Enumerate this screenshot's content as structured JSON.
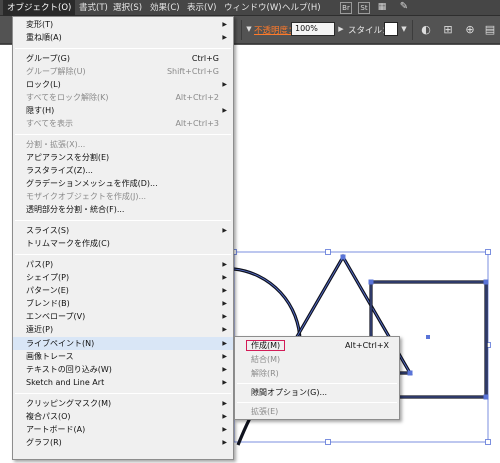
{
  "menubar": {
    "items": [
      "オブジェクト(O)",
      "書式(T)",
      "選択(S)",
      "効果(C)",
      "表示(V)",
      "ウィンドウ(W)",
      "ヘルプ(H)"
    ],
    "icon_br": "Br",
    "icon_st": "St"
  },
  "controlbar": {
    "opacity_label": "不透明度：",
    "opacity_value": "100%",
    "style_label": "スタイル：",
    "opacity_color": "#ff7a2a"
  },
  "menu": {
    "items": [
      {
        "label": "変形(T)",
        "submenu": true
      },
      {
        "label": "重ね順(A)",
        "submenu": true
      },
      {
        "label": "グループ(G)",
        "shortcut": "Ctrl+G"
      },
      {
        "label": "グループ解除(U)",
        "shortcut": "Shift+Ctrl+G",
        "disabled": true
      },
      {
        "label": "ロック(L)",
        "submenu": true
      },
      {
        "label": "すべてをロック解除(K)",
        "shortcut": "Alt+Ctrl+2",
        "disabled": true
      },
      {
        "label": "隠す(H)",
        "submenu": true
      },
      {
        "label": "すべてを表示",
        "shortcut": "Alt+Ctrl+3",
        "disabled": true
      },
      {
        "label": "分割・拡張(X)...",
        "disabled": true
      },
      {
        "label": "アピアランスを分割(E)"
      },
      {
        "label": "ラスタライズ(Z)..."
      },
      {
        "label": "グラデーションメッシュを作成(D)..."
      },
      {
        "label": "モザイクオブジェクトを作成(J)...",
        "disabled": true
      },
      {
        "label": "透明部分を分割・統合(F)..."
      },
      {
        "label": "スライス(S)",
        "submenu": true
      },
      {
        "label": "トリムマークを作成(C)"
      },
      {
        "label": "パス(P)",
        "submenu": true
      },
      {
        "label": "シェイプ(P)",
        "submenu": true
      },
      {
        "label": "パターン(E)",
        "submenu": true
      },
      {
        "label": "ブレンド(B)",
        "submenu": true
      },
      {
        "label": "エンベロープ(V)",
        "submenu": true
      },
      {
        "label": "遠近(P)",
        "submenu": true
      },
      {
        "label": "ライブペイント(N)",
        "submenu": true,
        "highlight": true
      },
      {
        "label": "画像トレース",
        "submenu": true
      },
      {
        "label": "テキストの回り込み(W)",
        "submenu": true
      },
      {
        "label": "Sketch and Line Art",
        "submenu": true
      },
      {
        "label": "クリッピングマスク(M)",
        "submenu": true
      },
      {
        "label": "複合パス(O)",
        "submenu": true
      },
      {
        "label": "アートボード(A)",
        "submenu": true
      },
      {
        "label": "グラフ(R)",
        "submenu": true
      }
    ]
  },
  "submenu": {
    "items": [
      {
        "label": "作成(M)",
        "shortcut": "Alt+Ctrl+X",
        "boxed": true
      },
      {
        "label": "結合(M)",
        "disabled": true
      },
      {
        "label": "解除(R)",
        "disabled": true
      },
      {
        "label": "隙間オプション(G)..."
      },
      {
        "label": "拡張(E)",
        "disabled": true
      }
    ],
    "box_color": "#d21c57"
  },
  "colors": {
    "selection": "#5a74d8",
    "shape_stroke": "#10131f",
    "menu_bg": "#f0f0f0",
    "menu_highlight": "#d9e6f6"
  }
}
